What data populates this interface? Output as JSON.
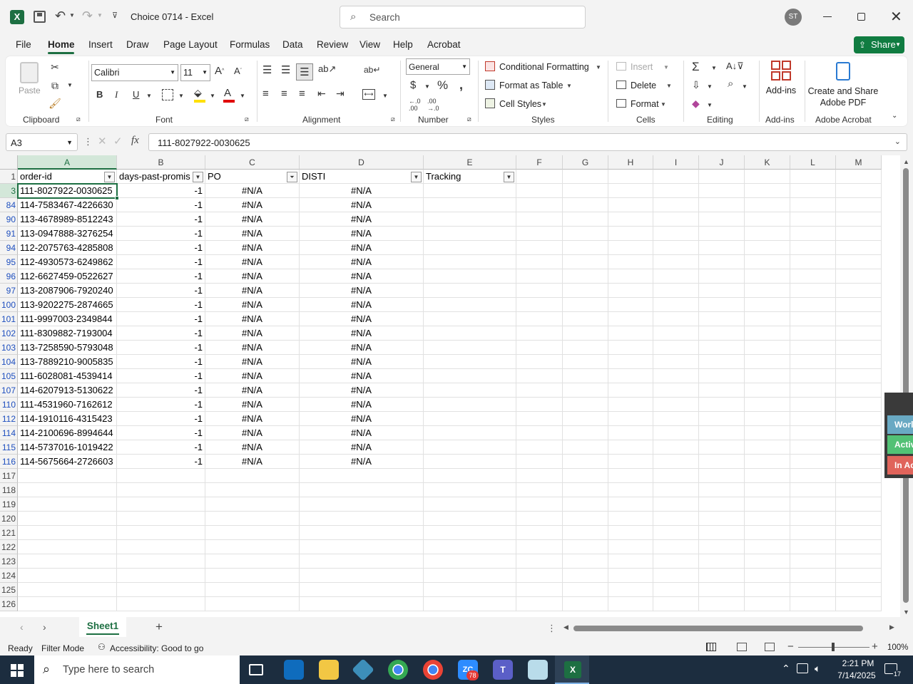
{
  "window": {
    "doc_title": "Choice 0714  -  Excel",
    "search_placeholder": "Search",
    "user_initials": "ST"
  },
  "menu_tabs": [
    "File",
    "Home",
    "Insert",
    "Draw",
    "Page Layout",
    "Formulas",
    "Data",
    "Review",
    "View",
    "Help",
    "Acrobat"
  ],
  "share_label": "Share",
  "ribbon": {
    "paste": "Paste",
    "font_name": "Calibri",
    "font_size": "11",
    "number_format": "General",
    "conditional_formatting": "Conditional Formatting",
    "format_as_table": "Format as Table",
    "cell_styles": "Cell Styles",
    "insert": "Insert",
    "delete": "Delete",
    "format": "Format",
    "addins": "Add-ins",
    "create_pdf_1": "Create and Share",
    "create_pdf_2": "Adobe PDF",
    "groups": {
      "clipboard": "Clipboard",
      "font": "Font",
      "alignment": "Alignment",
      "number": "Number",
      "styles": "Styles",
      "cells": "Cells",
      "editing": "Editing",
      "addins": "Add-ins",
      "acrobat": "Adobe Acrobat"
    }
  },
  "formula_bar": {
    "name_box": "A3",
    "fx": "fx",
    "content": "111-8027922-0030625"
  },
  "columns": [
    "A",
    "B",
    "C",
    "D",
    "E",
    "F",
    "G",
    "H",
    "I",
    "J",
    "K",
    "L",
    "M"
  ],
  "headers": [
    "order-id",
    "days-past-promis",
    "PO",
    "DISTI",
    "Tracking"
  ],
  "rows": [
    {
      "n": "1"
    },
    {
      "n": "3",
      "id": "111-8027922-0030625",
      "days": "-1",
      "po": "#N/A",
      "disti": "#N/A"
    },
    {
      "n": "84",
      "id": "114-7583467-4226630",
      "days": "-1",
      "po": "#N/A",
      "disti": "#N/A"
    },
    {
      "n": "90",
      "id": "113-4678989-8512243",
      "days": "-1",
      "po": "#N/A",
      "disti": "#N/A"
    },
    {
      "n": "91",
      "id": "113-0947888-3276254",
      "days": "-1",
      "po": "#N/A",
      "disti": "#N/A"
    },
    {
      "n": "94",
      "id": "112-2075763-4285808",
      "days": "-1",
      "po": "#N/A",
      "disti": "#N/A"
    },
    {
      "n": "95",
      "id": "112-4930573-6249862",
      "days": "-1",
      "po": "#N/A",
      "disti": "#N/A"
    },
    {
      "n": "96",
      "id": "112-6627459-0522627",
      "days": "-1",
      "po": "#N/A",
      "disti": "#N/A"
    },
    {
      "n": "97",
      "id": "113-2087906-7920240",
      "days": "-1",
      "po": "#N/A",
      "disti": "#N/A"
    },
    {
      "n": "100",
      "id": "113-9202275-2874665",
      "days": "-1",
      "po": "#N/A",
      "disti": "#N/A"
    },
    {
      "n": "101",
      "id": "111-9997003-2349844",
      "days": "-1",
      "po": "#N/A",
      "disti": "#N/A"
    },
    {
      "n": "102",
      "id": "111-8309882-7193004",
      "days": "-1",
      "po": "#N/A",
      "disti": "#N/A"
    },
    {
      "n": "103",
      "id": "113-7258590-5793048",
      "days": "-1",
      "po": "#N/A",
      "disti": "#N/A"
    },
    {
      "n": "104",
      "id": "113-7889210-9005835",
      "days": "-1",
      "po": "#N/A",
      "disti": "#N/A"
    },
    {
      "n": "105",
      "id": "111-6028081-4539414",
      "days": "-1",
      "po": "#N/A",
      "disti": "#N/A"
    },
    {
      "n": "107",
      "id": "114-6207913-5130622",
      "days": "-1",
      "po": "#N/A",
      "disti": "#N/A"
    },
    {
      "n": "110",
      "id": "111-4531960-7162612",
      "days": "-1",
      "po": "#N/A",
      "disti": "#N/A"
    },
    {
      "n": "112",
      "id": "114-1910116-4315423",
      "days": "-1",
      "po": "#N/A",
      "disti": "#N/A"
    },
    {
      "n": "114",
      "id": "114-2100696-8994644",
      "days": "-1",
      "po": "#N/A",
      "disti": "#N/A"
    },
    {
      "n": "115",
      "id": "114-5737016-1019422",
      "days": "-1",
      "po": "#N/A",
      "disti": "#N/A"
    },
    {
      "n": "116",
      "id": "114-5675664-2726603",
      "days": "-1",
      "po": "#N/A",
      "disti": "#N/A"
    },
    {
      "n": "117"
    },
    {
      "n": "118"
    },
    {
      "n": "119"
    },
    {
      "n": "120"
    },
    {
      "n": "121"
    },
    {
      "n": "122"
    },
    {
      "n": "123"
    },
    {
      "n": "124"
    },
    {
      "n": "125"
    },
    {
      "n": "126"
    }
  ],
  "sheet_tab": "Sheet1",
  "status": {
    "ready": "Ready",
    "filter_mode": "Filter Mode",
    "accessibility": "Accessibility: Good to go",
    "zoom": "100%"
  },
  "side_panel": [
    "Worl",
    "Activ",
    "In Ac"
  ],
  "taskbar": {
    "search_placeholder": "Type here to search",
    "time": "2:21 PM",
    "date": "7/14/2025",
    "zoom_badge": "78",
    "notif_count": "17"
  },
  "colors": {
    "excel_green": "#1d6f42",
    "share_green": "#107c41",
    "filtered_row_blue": "#1e4fbf",
    "taskbar": "#1c2d3f",
    "panel_teal": "#69a9c3",
    "panel_green": "#52c175",
    "panel_red": "#e0645b"
  }
}
